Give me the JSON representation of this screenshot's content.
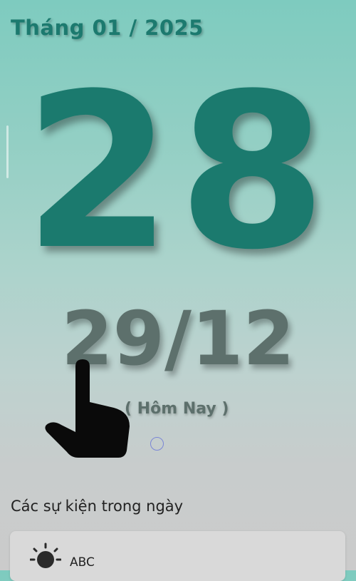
{
  "header": {
    "month_title": "Tháng 01 / 2025"
  },
  "calendar": {
    "day": "28",
    "lunar_date": "29/12",
    "today_label": "( Hôm Nay )"
  },
  "events": {
    "section_title": "Các sự kiện trong ngày",
    "items": [
      {
        "icon": "sun-icon",
        "name": "ABC"
      }
    ]
  },
  "colors": {
    "accent": "#1b7a6e",
    "lunar": "#5d706c"
  }
}
